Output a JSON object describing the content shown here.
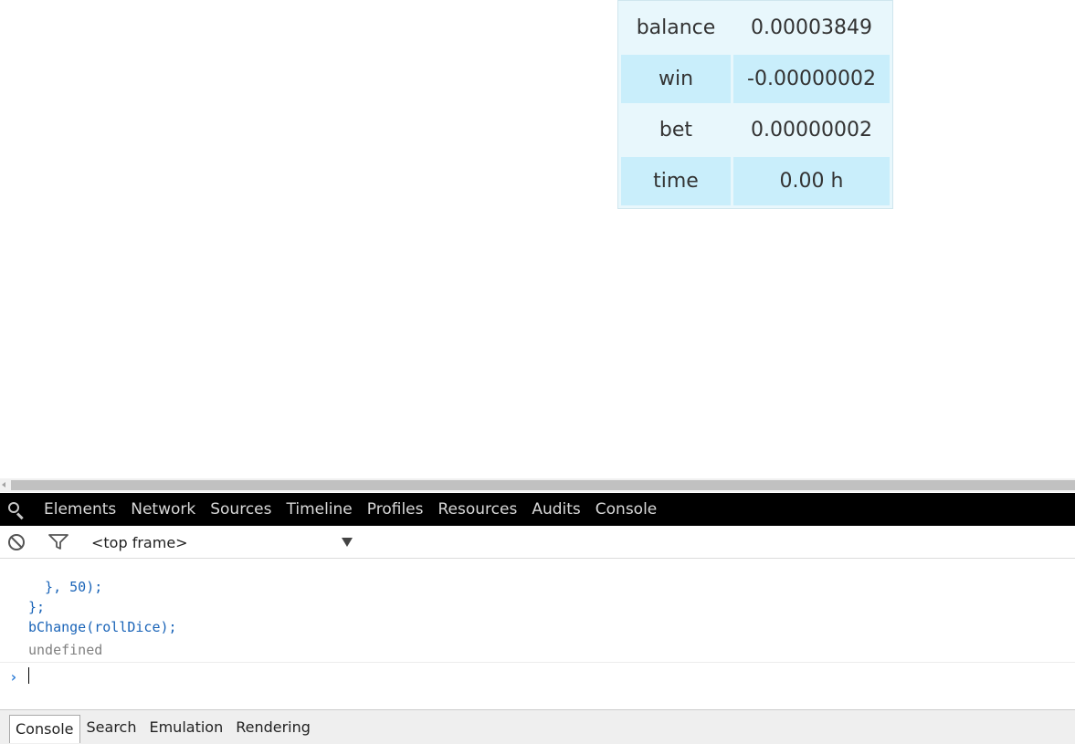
{
  "stats": [
    {
      "label": "balance",
      "value": "0.00003849"
    },
    {
      "label": "win",
      "value": "-0.00000002"
    },
    {
      "label": "bet",
      "value": "0.00000002"
    },
    {
      "label": "time",
      "value": "0.00 h"
    }
  ],
  "devtools": {
    "tabs": [
      "Elements",
      "Network",
      "Sources",
      "Timeline",
      "Profiles",
      "Resources",
      "Audits",
      "Console"
    ],
    "frame_select": "<top frame>"
  },
  "console": {
    "lines": [
      "  }, 50);",
      "};",
      "bChange(rollDice);"
    ],
    "result": "undefined",
    "prompt_value": ""
  },
  "drawer": {
    "tabs": [
      "Console",
      "Search",
      "Emulation",
      "Rendering"
    ],
    "selected": "Console"
  },
  "colors": {
    "stat_bg": "#e8f7fc",
    "stat_alt_bg": "#c9eefb",
    "code_blue": "#1a64b8",
    "devtools_bar": "#000000"
  },
  "icons": {
    "devtools_search": "search-icon",
    "clear_console": "clear-icon",
    "filter": "filter-icon",
    "frame_dropdown": "caret-down-icon",
    "prompt": "chevron-right-icon"
  }
}
